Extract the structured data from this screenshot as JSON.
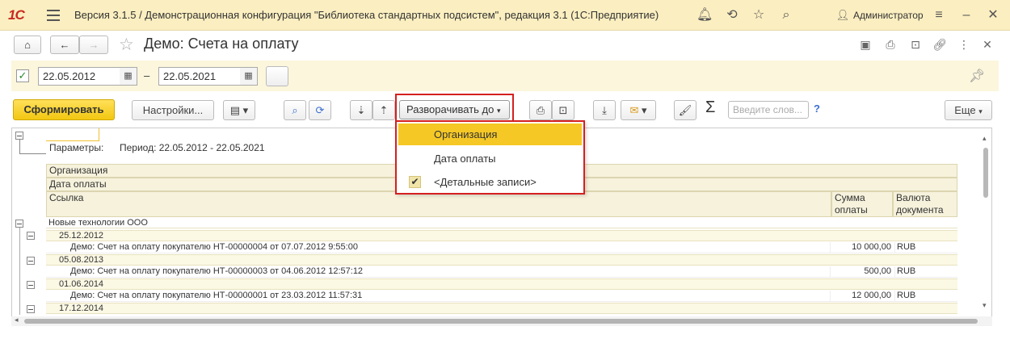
{
  "app": {
    "logo": "1С",
    "title": "Версия 3.1.5 / Демонстрационная конфигурация \"Библиотека стандартных подсистем\", редакция 3.1  (1С:Предприятие)",
    "user": "Администратор"
  },
  "form": {
    "title": "Демо: Счета на оплату"
  },
  "period": {
    "enabled_mark": "✓",
    "date_from": "22.05.2012",
    "separator": "–",
    "date_to": "22.05.2021"
  },
  "toolbar": {
    "generate": "Сформировать",
    "settings": "Настройки...",
    "expand_to": "Разворачивать до",
    "search_placeholder": "Введите слов...",
    "help": "?",
    "more": "Еще",
    "sigma": "Σ"
  },
  "dropdown": {
    "items": [
      {
        "label": "Организация",
        "selected": true,
        "checked": false
      },
      {
        "label": "Дата оплаты",
        "selected": false,
        "checked": false
      },
      {
        "label": "<Детальные записи>",
        "selected": false,
        "checked": true
      }
    ],
    "check_mark": "✔"
  },
  "report": {
    "params_label": "Параметры:",
    "params_value": "Период: 22.05.2012 - 22.05.2021",
    "header_rows": [
      "Организация",
      "Дата оплаты"
    ],
    "columns": {
      "link": "Ссылка",
      "sum": "Сумма оплаты",
      "currency": "Валюта документа"
    },
    "organization": "Новые технологии ООО",
    "groups": [
      {
        "date": "25.12.2012",
        "rows": [
          {
            "doc": "Демо: Счет на оплату покупателю НТ-00000004 от 07.07.2012 9:55:00",
            "sum": "10 000,00",
            "currency": "RUB"
          }
        ]
      },
      {
        "date": "05.08.2013",
        "rows": [
          {
            "doc": "Демо: Счет на оплату покупателю НТ-00000003 от 04.06.2012 12:57:12",
            "sum": "500,00",
            "currency": "RUB"
          }
        ]
      },
      {
        "date": "01.06.2014",
        "rows": [
          {
            "doc": "Демо: Счет на оплату покупателю НТ-00000001 от 23.03.2012 11:57:31",
            "sum": "12 000,00",
            "currency": "RUB"
          }
        ]
      },
      {
        "date": "17.12.2014",
        "rows": []
      }
    ]
  }
}
